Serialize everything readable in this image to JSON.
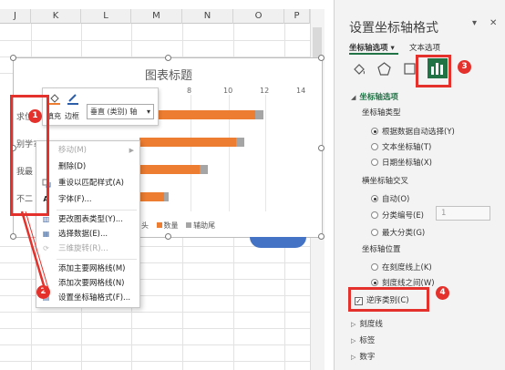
{
  "sheet": {
    "columns": [
      "J",
      "K",
      "L",
      "M",
      "N",
      "O",
      "P"
    ]
  },
  "chart": {
    "title": "图表标题",
    "x_ticks": [
      "8",
      "10",
      "12",
      "14"
    ],
    "category_labels": [
      "求位",
      "别学?",
      "我最",
      "不二"
    ],
    "legend": [
      "数量",
      "辅助尾"
    ],
    "legend_prefix": "头",
    "colors": {
      "number": "#ed7d31",
      "aux": "#a5a5a5"
    }
  },
  "mini_toolbar": {
    "fill_label": "填充",
    "border_label": "边框",
    "axis_select_value": "垂直 (类别) 轴"
  },
  "context_menu": {
    "items": [
      {
        "label": "移动(M)",
        "disabled": true,
        "icon": "move-icon",
        "glyph": "",
        "submenu": true
      },
      {
        "label": "删除(D)",
        "disabled": false,
        "icon": "delete-icon",
        "glyph": ""
      },
      {
        "label": "重设以匹配样式(A)",
        "disabled": false,
        "icon": "reset-style-icon",
        "glyph": ""
      },
      {
        "label": "字体(F)...",
        "disabled": false,
        "icon": "font-icon",
        "glyph": "A"
      },
      {
        "label": "更改图表类型(Y)...",
        "disabled": false,
        "icon": "chart-type-icon",
        "glyph": "▥"
      },
      {
        "label": "选择数据(E)...",
        "disabled": false,
        "icon": "select-data-icon",
        "glyph": "▦"
      },
      {
        "label": "三维旋转(R)...",
        "disabled": true,
        "icon": "3d-rotation-icon",
        "glyph": "⟳"
      },
      {
        "label": "添加主要网格线(M)",
        "disabled": false,
        "icon": "major-gridlines-icon",
        "glyph": ""
      },
      {
        "label": "添加次要网格线(N)",
        "disabled": false,
        "icon": "minor-gridlines-icon",
        "glyph": ""
      },
      {
        "label": "设置坐标轴格式(F)...",
        "disabled": false,
        "icon": "format-axis-icon",
        "glyph": "▤"
      }
    ]
  },
  "badges": [
    "1",
    "2",
    "3",
    "4"
  ],
  "pane": {
    "title": "设置坐标轴格式",
    "dropdown_chevron": "▾",
    "close_glyph": "✕",
    "tabs": [
      "坐标轴选项 ▾",
      "文本选项"
    ],
    "axis_options_head": "坐标轴选项",
    "axis_type_head": "坐标轴类型",
    "axis_type_options": [
      {
        "label": "根据数据自动选择(Y)",
        "on": true
      },
      {
        "label": "文本坐标轴(T)",
        "on": false
      },
      {
        "label": "日期坐标轴(X)",
        "on": false
      }
    ],
    "cross_head": "横坐标轴交叉",
    "cross_options": [
      {
        "label": "自动(O)",
        "on": true
      },
      {
        "label": "分类编号(E)",
        "on": false
      },
      {
        "label": "最大分类(G)",
        "on": false
      }
    ],
    "cross_value": "1",
    "position_head": "坐标轴位置",
    "position_options": [
      {
        "label": "在刻度线上(K)",
        "on": false
      },
      {
        "label": "刻度线之间(W)",
        "on": true
      }
    ],
    "reverse_order_label": "逆序类别(C)",
    "reverse_order_checked": true,
    "collapsed_sections": [
      "刻度线",
      "标签",
      "数字"
    ],
    "accent_color": "#217346",
    "annotation_color": "#e4312b"
  }
}
